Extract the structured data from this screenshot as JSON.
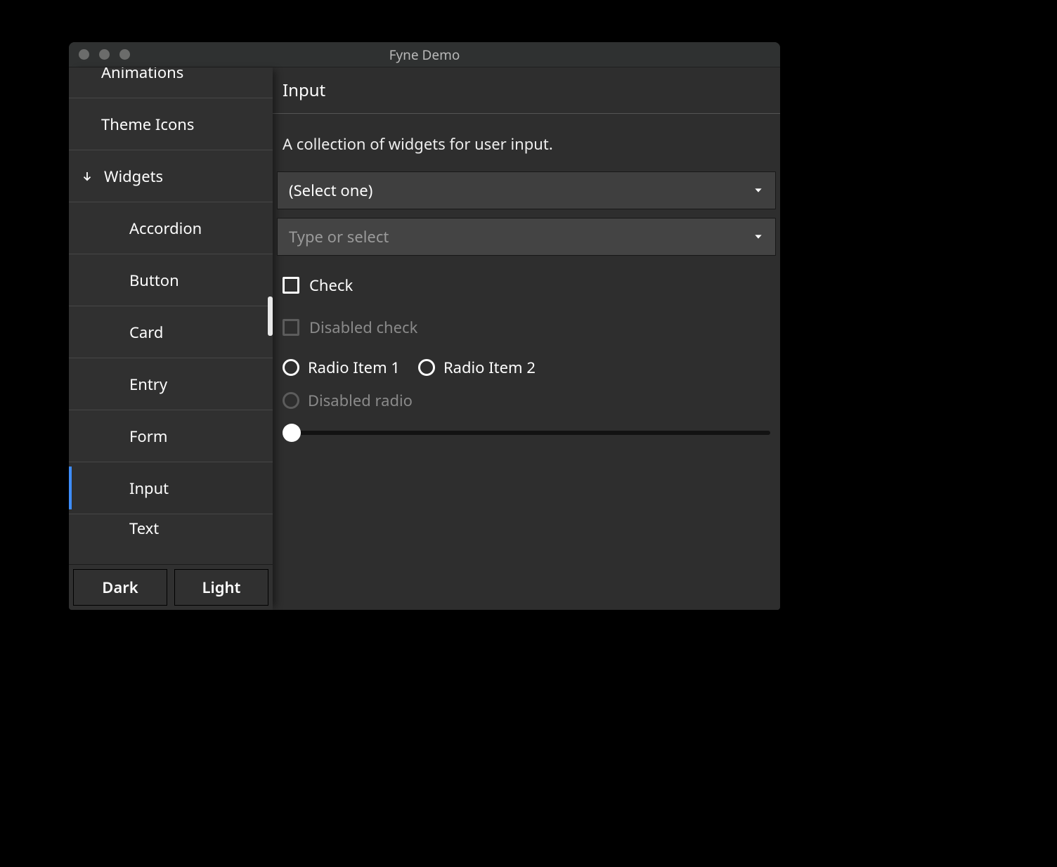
{
  "window": {
    "title": "Fyne Demo"
  },
  "sidebar": {
    "items": [
      {
        "id": "animations",
        "label": "Animations"
      },
      {
        "id": "theme-icons",
        "label": "Theme Icons"
      },
      {
        "id": "widgets",
        "label": "Widgets",
        "expanded": true,
        "children": [
          {
            "id": "accordion",
            "label": "Accordion"
          },
          {
            "id": "button",
            "label": "Button"
          },
          {
            "id": "card",
            "label": "Card"
          },
          {
            "id": "entry",
            "label": "Entry"
          },
          {
            "id": "form",
            "label": "Form"
          },
          {
            "id": "input",
            "label": "Input",
            "selected": true
          },
          {
            "id": "text",
            "label": "Text"
          }
        ]
      }
    ],
    "theme_buttons": {
      "dark": "Dark",
      "light": "Light"
    }
  },
  "page": {
    "title": "Input",
    "description": "A collection of widgets for user input.",
    "select_placeholder": "(Select one)",
    "combo_placeholder": "Type or select",
    "check_label": "Check",
    "disabled_check_label": "Disabled check",
    "radio1_label": "Radio Item 1",
    "radio2_label": "Radio Item 2",
    "disabled_radio_label": "Disabled radio",
    "slider_value": 0
  }
}
